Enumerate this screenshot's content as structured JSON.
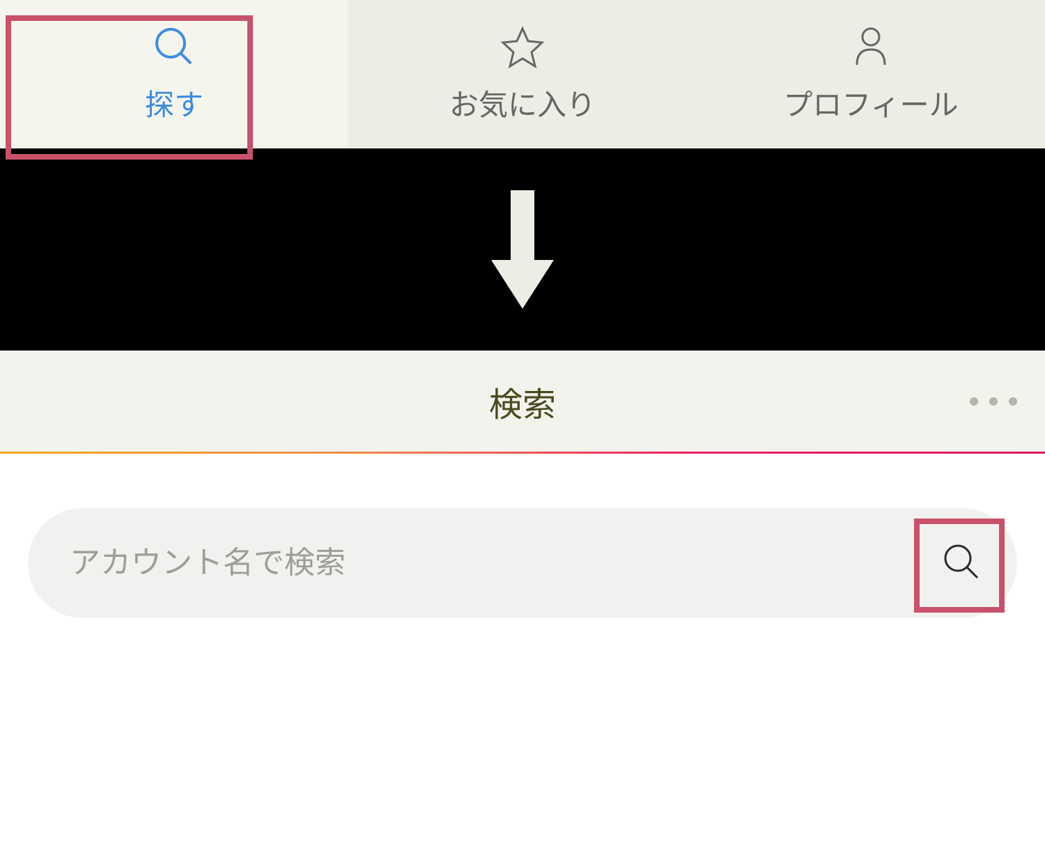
{
  "tabs": {
    "search": {
      "label": "探す",
      "active": true
    },
    "favorites": {
      "label": "お気に入り",
      "active": false
    },
    "profile": {
      "label": "プロフィール",
      "active": false
    }
  },
  "header": {
    "title": "検索"
  },
  "search": {
    "placeholder": "アカウント名で検索",
    "value": ""
  },
  "colors": {
    "accent_blue": "#3b8de0",
    "highlight_pink": "#c9526a",
    "tab_bg": "#edede5",
    "header_bg": "#f3f3ee",
    "search_bg": "#f1f1ef"
  }
}
